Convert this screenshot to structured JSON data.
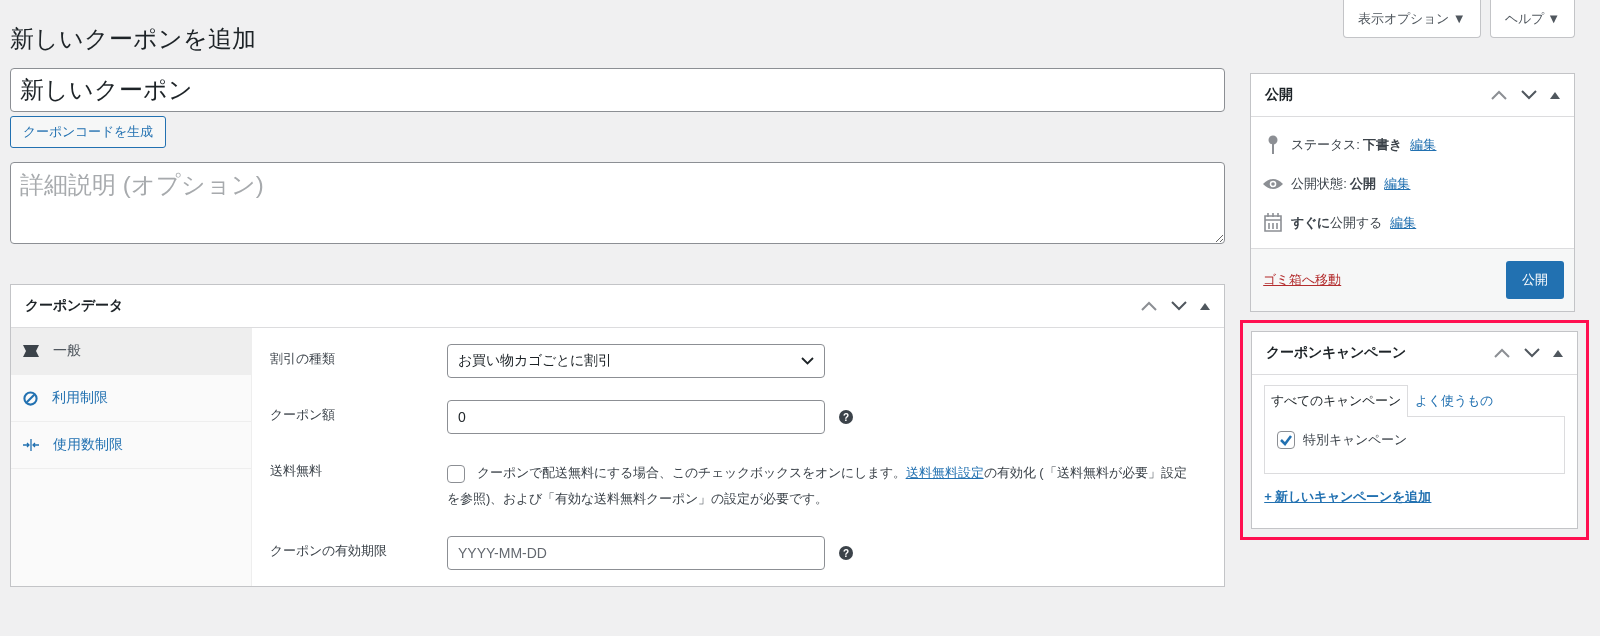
{
  "top_buttons": [
    {
      "label": "表示オプション",
      "caret": "▼"
    },
    {
      "label": "ヘルプ",
      "caret": "▼"
    }
  ],
  "page_title": "新しいクーポンを追加",
  "title_field": {
    "value": "新しいクーポン"
  },
  "generate_button": "クーポンコードを生成",
  "description_field": {
    "placeholder": "詳細説明 (オプション)"
  },
  "coupon_data": {
    "title": "クーポンデータ",
    "tabs": [
      {
        "label": "一般",
        "kind": "ticket",
        "selected": true
      },
      {
        "label": "利用制限",
        "kind": "block",
        "selected": false
      },
      {
        "label": "使用数制限",
        "kind": "limit",
        "selected": false
      }
    ],
    "fields": [
      {
        "label": "割引の種類",
        "kind": "select",
        "value": "お買い物カゴごとに割引"
      },
      {
        "label": "クーポン額",
        "kind": "text",
        "value": "0",
        "help": "?"
      },
      {
        "label": "送料無料",
        "kind": "checkbox",
        "checked": false,
        "before": "クーポンで配送無料にする場合、このチェックボックスをオンにします。",
        "link": "送料無料設定",
        "after": "の有効化 (「送料無料が必要」設定を参照)、および「有効な送料無料クーポン」の設定が必要です。"
      },
      {
        "label": "クーポンの有効期限",
        "kind": "text",
        "placeholder": "YYYY-MM-DD",
        "help": "?"
      }
    ]
  },
  "publish_box": {
    "title": "公開",
    "rows": [
      {
        "kind": "pin",
        "label": "ステータス:",
        "value": "下書き",
        "link": "編集"
      },
      {
        "kind": "eye",
        "label": "公開状態:",
        "value": "公開",
        "link": "編集"
      },
      {
        "kind": "calendar",
        "value": "すぐに",
        "label": "公開する",
        "link": "編集"
      }
    ],
    "trash_link": "ゴミ箱へ移動",
    "publish_button": "公開"
  },
  "campaign_box": {
    "title": "クーポンキャンペーン",
    "highlighted": true,
    "tabs": [
      {
        "label": "すべてのキャンペーン",
        "selected": true
      },
      {
        "label": "よく使うもの",
        "selected": false
      }
    ],
    "items": [
      {
        "label": "特別キャンペーン",
        "checked": true
      }
    ],
    "add_link": "+ 新しいキャンペーンを追加"
  }
}
